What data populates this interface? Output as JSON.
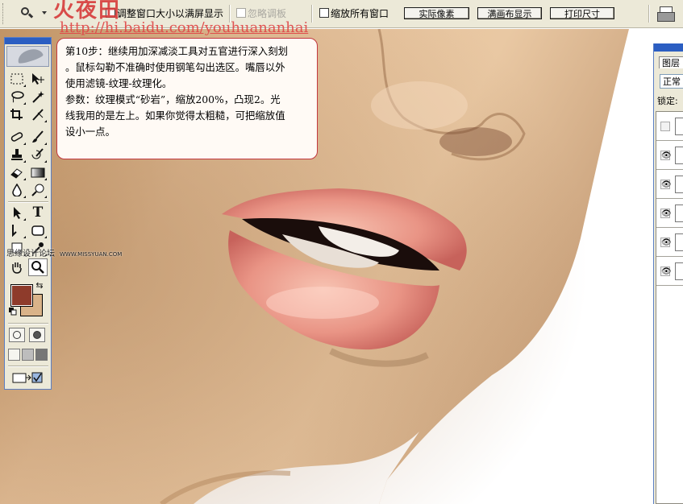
{
  "options_bar": {
    "resize_windows_label": "调整窗口大小以满屏显示",
    "ignore_palettes_label": "忽略调板",
    "zoom_all_windows_label": "缩放所有窗口",
    "actual_pixels_label": "实际像素",
    "fit_screen_label": "满画布显示",
    "print_size_label": "打印尺寸"
  },
  "watermark": {
    "title": "火夜田",
    "url": "http://hi.baidu.com/youhuananhai",
    "forum": "思缘设计论坛",
    "forum_url": "WWW.MISSYUAN.COM"
  },
  "note": {
    "lines": [
      "第10步：继续用加深减淡工具对五官进行深入刻划",
      "。鼠标勾勒不准确时使用钢笔勾出选区。嘴唇以外",
      "使用滤镜-纹理-纹理化。",
      "参数：纹理模式“砂岩”，缩放200%，凸现2。光",
      "线我用的是左上。如果你觉得太粗糙，可把缩放值",
      "设小一点。"
    ]
  },
  "toolbox": {
    "foreground_color": "#8e3b2b",
    "background_color": "#d9b389",
    "tools": [
      "marquee-tool",
      "move-tool",
      "lasso-tool",
      "magic-wand-tool",
      "crop-tool",
      "slice-tool",
      "healing-brush-tool",
      "brush-tool",
      "clone-stamp-tool",
      "history-brush-tool",
      "eraser-tool",
      "gradient-tool",
      "blur-tool",
      "dodge-tool",
      "path-selection-tool",
      "type-tool",
      "pen-tool",
      "shape-tool",
      "notes-tool",
      "eyedropper-tool",
      "hand-tool",
      "zoom-tool"
    ],
    "type_tool_glyph": "T",
    "active_tool": "zoom-tool"
  },
  "layers_panel": {
    "tab_label": "图层",
    "blend_mode": "正常",
    "lock_label": "锁定:"
  }
}
